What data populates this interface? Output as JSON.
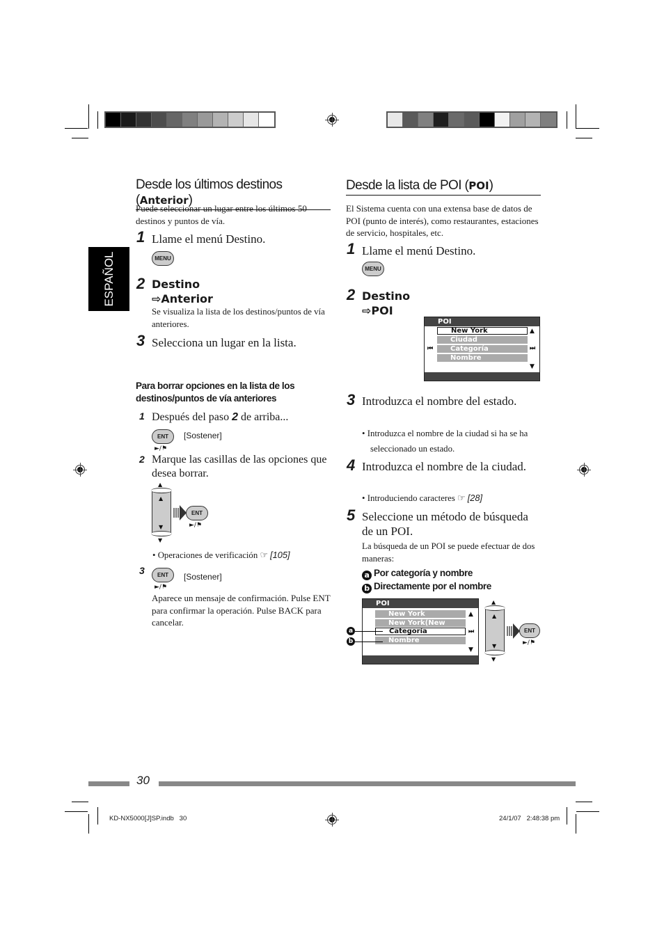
{
  "side_tab": {
    "label": "ESPAÑOL"
  },
  "color_bar_left": [
    "#000000",
    "#1a1a1a",
    "#333333",
    "#4d4d4d",
    "#666666",
    "#808080",
    "#999999",
    "#b3b3b3",
    "#cccccc",
    "#e6e6e6",
    "#ffffff"
  ],
  "color_bar_right": [
    "#e8e8e8",
    "#5a5a5a",
    "#808080",
    "#1e1e1e",
    "#6a6a6a",
    "#5a5a5a",
    "#000000",
    "#f2f2f2",
    "#a0a0a0",
    "#b3b3b3",
    "#7f7f7f"
  ],
  "left": {
    "title": "Desde los últimos destinos (",
    "title_bold": "Anterior",
    "title_end": ")",
    "intro": "Puede seleccionar un lugar entre los últimos 50 destinos y puntos de vía.",
    "steps": [
      {
        "num": "1",
        "text": "Llame el menú Destino.",
        "button": "MENU"
      },
      {
        "num": "2",
        "line1": "Destino",
        "line2": "⇨Anterior",
        "note": "Se visualiza la lista de los destinos/puntos de vía anteriores."
      },
      {
        "num": "3",
        "text": "Selecciona un lugar en la lista."
      }
    ],
    "delete_section": {
      "heading": "Para borrar opciones en la lista de los destinos/puntos de vía anteriores",
      "sub1_num": "1",
      "sub1_text_a": "Después del paso ",
      "sub1_text_bold": "2",
      "sub1_text_b": " de arriba...",
      "ent_label": "ENT",
      "hold": "[Sostener]",
      "play_symbol": "►/⚑",
      "sub2_num": "2",
      "sub2_text": "Marque las casillas de las opciones que desea borrar.",
      "bullet_verif": "Operaciones de verificación",
      "ref_verif": "[105]",
      "sub3_num": "3",
      "sub3_note": "Aparece un mensaje de confirmación. Pulse ENT para confirmar la operación. Pulse BACK para cancelar."
    }
  },
  "right": {
    "title": "Desde la lista de POI (",
    "title_bold": "POI",
    "title_end": ")",
    "intro": "El Sistema cuenta con una extensa base de datos de POI (punto de interés), como restaurantes, estaciones de servicio, hospitales, etc.",
    "steps": [
      {
        "num": "1",
        "text": "Llame el menú Destino.",
        "button": "MENU"
      },
      {
        "num": "2",
        "line1": "Destino",
        "line2": "⇨POI"
      },
      {
        "num": "3",
        "text": "Introduzca el nombre del estado.",
        "bullet": "Introduzca el nombre de la ciudad si ha se ha seleccionado un estado."
      },
      {
        "num": "4",
        "text": "Introduzca el nombre de la ciudad.",
        "bullet": "Introduciendo caracteres",
        "ref": "[28]"
      },
      {
        "num": "5",
        "text": "Seleccione un método de búsqueda de un POI.",
        "note": "La búsqueda de un POI se puede efectuar de dos maneras:"
      }
    ],
    "methods": [
      {
        "marker": "a",
        "label": "Por categoría y nombre"
      },
      {
        "marker": "b",
        "label": "Directamente por el nombre"
      }
    ],
    "screen1": {
      "title": "POI",
      "items": [
        "New York",
        "Ciudad",
        "Categoría",
        "Nombre"
      ],
      "selected_index": 0
    },
    "screen2": {
      "title": "POI",
      "items": [
        "New York",
        "New York(New York)",
        "Categoría",
        "Nombre"
      ],
      "selected_index": 2
    },
    "ent_label": "ENT",
    "play_symbol": "►/⚑"
  },
  "footer": {
    "page_number": "30",
    "file_info": "KD-NX5000[J]SP.indb   30",
    "timestamp": "24/1/07   2:48:38 pm"
  },
  "icons": {
    "pointer": "☞",
    "prev": "⏮",
    "next": "⏭",
    "up": "▲",
    "down": "▼"
  }
}
